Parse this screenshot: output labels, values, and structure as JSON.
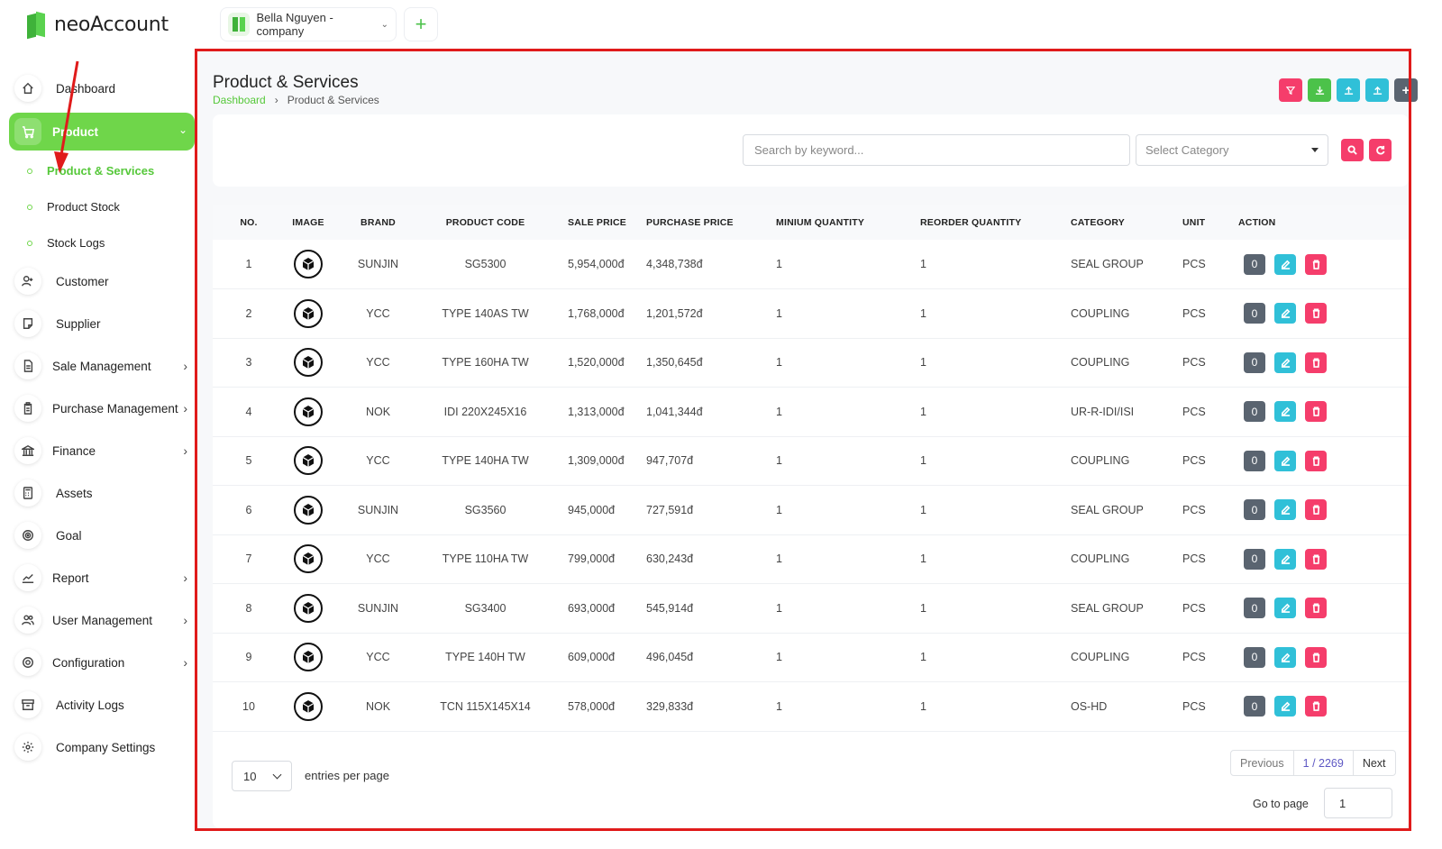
{
  "app": {
    "name": "neoAccount"
  },
  "company": {
    "name": "Bella Nguyen - company"
  },
  "sidebar": {
    "items": [
      {
        "label": "Dashboard",
        "icon": "home-icon",
        "arrow": false
      },
      {
        "label": "Product",
        "icon": "cart-icon",
        "arrow": true
      },
      {
        "label": "Customer",
        "icon": "user-plus-icon",
        "arrow": false
      },
      {
        "label": "Supplier",
        "icon": "sticky-note-icon",
        "arrow": false
      },
      {
        "label": "Sale Management",
        "icon": "document-icon",
        "arrow": true
      },
      {
        "label": "Purchase Management",
        "icon": "clipboard-icon",
        "arrow": true
      },
      {
        "label": "Finance",
        "icon": "bank-icon",
        "arrow": true
      },
      {
        "label": "Assets",
        "icon": "calculator-icon",
        "arrow": false
      },
      {
        "label": "Goal",
        "icon": "target-icon",
        "arrow": false
      },
      {
        "label": "Report",
        "icon": "chart-line-icon",
        "arrow": true
      },
      {
        "label": "User Management",
        "icon": "users-icon",
        "arrow": true
      },
      {
        "label": "Configuration",
        "icon": "gear-icon",
        "arrow": true
      },
      {
        "label": "Activity Logs",
        "icon": "archive-icon",
        "arrow": false
      },
      {
        "label": "Company Settings",
        "icon": "settings-icon",
        "arrow": false
      }
    ],
    "product_sub": [
      "Product & Services",
      "Product Stock",
      "Stock Logs"
    ]
  },
  "page": {
    "title": "Product & Services",
    "breadcrumb": [
      "Dashboard",
      "Product & Services"
    ]
  },
  "filters": {
    "search_placeholder": "Search by keyword...",
    "category_placeholder": "Select Category"
  },
  "table": {
    "columns": [
      "NO.",
      "IMAGE",
      "BRAND",
      "PRODUCT CODE",
      "SALE PRICE",
      "PURCHASE PRICE",
      "MINIUM QUANTITY",
      "REORDER QUANTITY",
      "CATEGORY",
      "UNIT",
      "ACTION"
    ],
    "rows": [
      {
        "no": "1",
        "brand": "SUNJIN",
        "code": "SG5300",
        "sale": "5,954,000đ",
        "purchase": "4,348,738đ",
        "min": "1",
        "reorder": "1",
        "category": "SEAL GROUP",
        "unit": "PCS",
        "count": "0"
      },
      {
        "no": "2",
        "brand": "YCC",
        "code": "TYPE 140AS TW",
        "sale": "1,768,000đ",
        "purchase": "1,201,572đ",
        "min": "1",
        "reorder": "1",
        "category": "COUPLING",
        "unit": "PCS",
        "count": "0"
      },
      {
        "no": "3",
        "brand": "YCC",
        "code": "TYPE 160HA TW",
        "sale": "1,520,000đ",
        "purchase": "1,350,645đ",
        "min": "1",
        "reorder": "1",
        "category": "COUPLING",
        "unit": "PCS",
        "count": "0"
      },
      {
        "no": "4",
        "brand": "NOK",
        "code": "IDI 220X245X16",
        "sale": "1,313,000đ",
        "purchase": "1,041,344đ",
        "min": "1",
        "reorder": "1",
        "category": "UR-R-IDI/ISI",
        "unit": "PCS",
        "count": "0"
      },
      {
        "no": "5",
        "brand": "YCC",
        "code": "TYPE 140HA TW",
        "sale": "1,309,000đ",
        "purchase": "947,707đ",
        "min": "1",
        "reorder": "1",
        "category": "COUPLING",
        "unit": "PCS",
        "count": "0"
      },
      {
        "no": "6",
        "brand": "SUNJIN",
        "code": "SG3560",
        "sale": "945,000đ",
        "purchase": "727,591đ",
        "min": "1",
        "reorder": "1",
        "category": "SEAL GROUP",
        "unit": "PCS",
        "count": "0"
      },
      {
        "no": "7",
        "brand": "YCC",
        "code": "TYPE 110HA TW",
        "sale": "799,000đ",
        "purchase": "630,243đ",
        "min": "1",
        "reorder": "1",
        "category": "COUPLING",
        "unit": "PCS",
        "count": "0"
      },
      {
        "no": "8",
        "brand": "SUNJIN",
        "code": "SG3400",
        "sale": "693,000đ",
        "purchase": "545,914đ",
        "min": "1",
        "reorder": "1",
        "category": "SEAL GROUP",
        "unit": "PCS",
        "count": "0"
      },
      {
        "no": "9",
        "brand": "YCC",
        "code": "TYPE 140H TW",
        "sale": "609,000đ",
        "purchase": "496,045đ",
        "min": "1",
        "reorder": "1",
        "category": "COUPLING",
        "unit": "PCS",
        "count": "0"
      },
      {
        "no": "10",
        "brand": "NOK",
        "code": "TCN 115X145X14",
        "sale": "578,000đ",
        "purchase": "329,833đ",
        "min": "1",
        "reorder": "1",
        "category": "OS-HD",
        "unit": "PCS",
        "count": "0"
      }
    ]
  },
  "pagination": {
    "per_page": "10",
    "per_page_label": "entries per page",
    "previous": "Previous",
    "current": "1 / 2269",
    "next": "Next",
    "goto_label": "Go to page",
    "goto_value": "1"
  },
  "colors": {
    "accent": "#6fd64a",
    "danger": "#f53d6b",
    "info": "#30c0d8",
    "annotation": "#e01b1b"
  }
}
